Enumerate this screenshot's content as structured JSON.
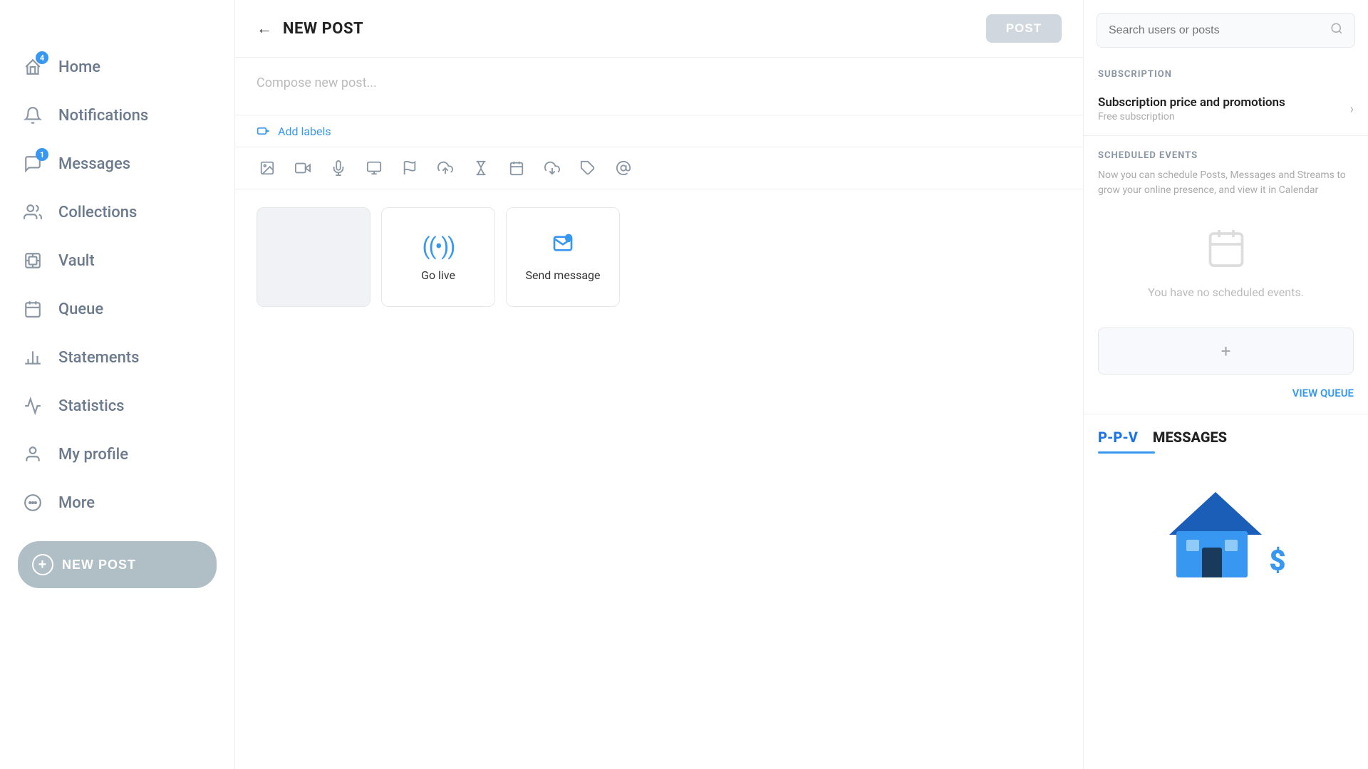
{
  "sidebar": {
    "items": [
      {
        "id": "home",
        "label": "Home",
        "icon": "🏠",
        "badge": 4
      },
      {
        "id": "notifications",
        "label": "Notifications",
        "icon": "🔔",
        "badge": null
      },
      {
        "id": "messages",
        "label": "Messages",
        "icon": "💬",
        "badge": 1
      },
      {
        "id": "collections",
        "label": "Collections",
        "icon": "👥",
        "badge": null
      },
      {
        "id": "vault",
        "label": "Vault",
        "icon": "📊",
        "badge": null
      },
      {
        "id": "queue",
        "label": "Queue",
        "icon": "📅",
        "badge": null
      },
      {
        "id": "statements",
        "label": "Statements",
        "icon": "📈",
        "badge": null
      },
      {
        "id": "statistics",
        "label": "Statistics",
        "icon": "📉",
        "badge": null
      },
      {
        "id": "my-profile",
        "label": "My profile",
        "icon": "👤",
        "badge": null
      },
      {
        "id": "more",
        "label": "More",
        "icon": "⊙",
        "badge": null
      }
    ],
    "new_post_button": "NEW POST"
  },
  "main": {
    "header": {
      "title": "NEW POST",
      "post_button": "POST"
    },
    "compose_placeholder": "Compose new post...",
    "add_labels": "Add labels",
    "toolbar_icons": [
      "🖼",
      "🎥",
      "🎙",
      "💻",
      "🚩",
      "⬆",
      "⏳",
      "📅",
      "⬇",
      "🏷",
      "@"
    ],
    "cards": [
      {
        "id": "blank",
        "type": "blank",
        "icon": "",
        "label": ""
      },
      {
        "id": "go-live",
        "type": "live",
        "icon": "((•))",
        "label": "Go live"
      },
      {
        "id": "send-message",
        "type": "message",
        "icon": "✉+",
        "label": "Send message"
      }
    ]
  },
  "right_panel": {
    "search_placeholder": "Search users or posts",
    "subscription": {
      "section_title": "SUBSCRIPTION",
      "row_title": "Subscription price and promotions",
      "row_subtitle": "Free subscription"
    },
    "scheduled_events": {
      "section_title": "SCHEDULED EVENTS",
      "description": "Now you can schedule Posts, Messages and Streams to grow your online presence, and view it in Calendar",
      "no_events_text": "You have no scheduled events.",
      "view_queue_label": "VIEW QUEUE"
    },
    "ppv": {
      "title_blue": "P-P-V",
      "title_dark": "MESSAGES"
    }
  }
}
